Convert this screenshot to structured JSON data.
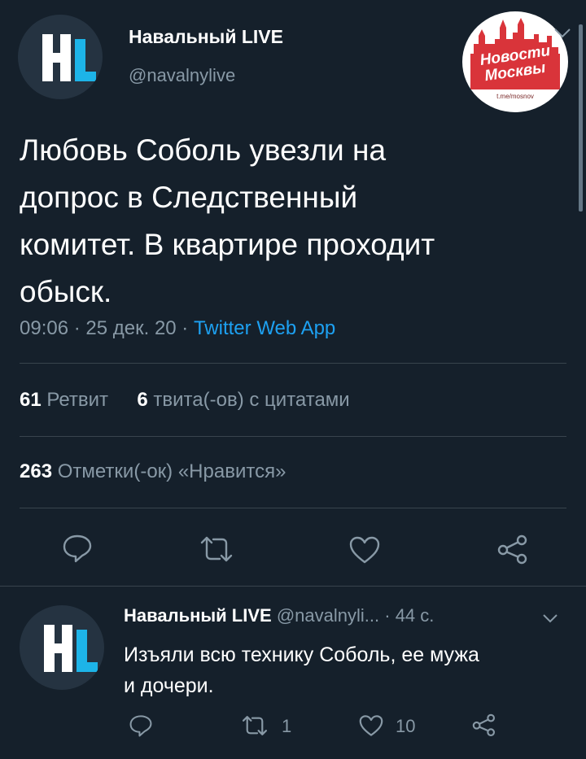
{
  "tweet": {
    "author_name": "Навальный LIVE",
    "author_handle": "@navalnylive",
    "text_lines": [
      "Любовь Соболь увезли на",
      "допрос в Следственный",
      "комитет. В квартире проходит",
      "обыск."
    ],
    "meta_time_date": "09:06 · 25 дек. 20 · ",
    "meta_source": "Twitter Web App",
    "retweets_count": "61",
    "retweets_label": "Ретвит",
    "quotes_count": "6",
    "quotes_label": "твита(-ов) с цитатами",
    "likes_count": "263",
    "likes_label": "Отметки(-ок) «Нравится»"
  },
  "reply": {
    "author_name": "Навальный LIVE",
    "author_handle": "@navalnyli...",
    "time": "· 44 с.",
    "text_lines": [
      "Изъяли всю технику Соболь, ее мужа",
      "и дочери."
    ],
    "retweets": "1",
    "likes": "10"
  },
  "overlay": {
    "line1": "Новости",
    "line2": "Москвы",
    "url": "t.me/mosnov"
  },
  "colors": {
    "background": "#15202b",
    "accent": "#1da1f2",
    "muted": "#8899a6",
    "divider": "#38444d"
  },
  "icons": [
    "reply-icon",
    "retweet-icon",
    "like-icon",
    "share-icon",
    "chevron-down-icon"
  ]
}
